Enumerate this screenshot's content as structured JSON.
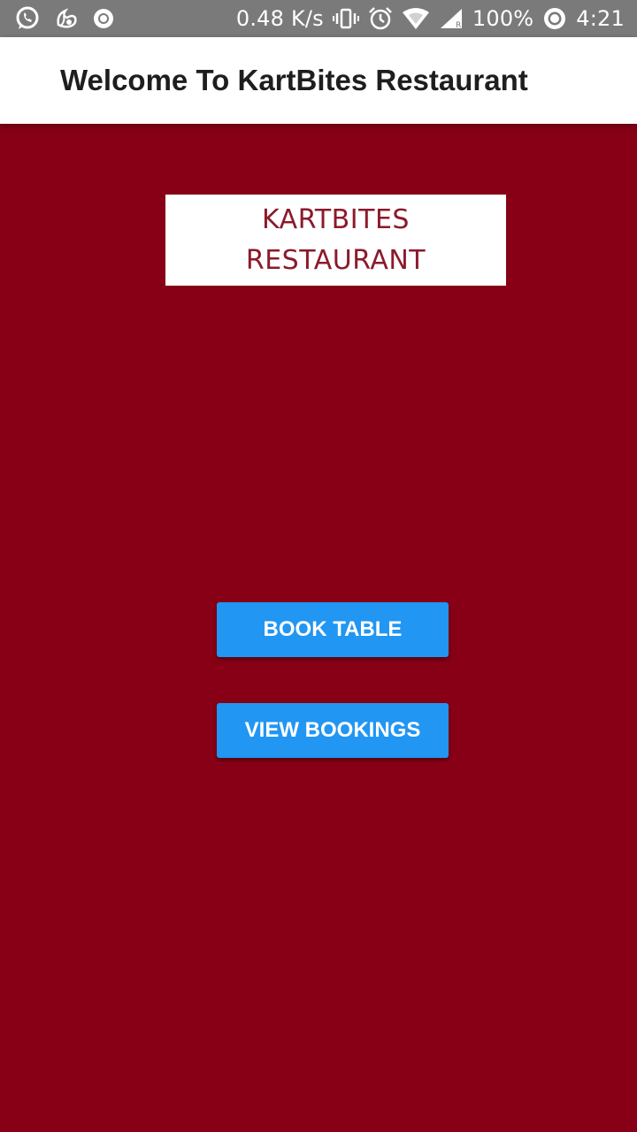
{
  "status_bar": {
    "network_speed": "0.48 K/s",
    "battery": "100%",
    "time": "4:21",
    "icons": [
      "whatsapp-icon",
      "uc-browser-icon",
      "record-icon",
      "vibrate-icon",
      "alarm-icon",
      "wifi-icon",
      "cell-signal-icon",
      "battery-saver-icon"
    ]
  },
  "app_bar": {
    "title": "Welcome To KartBites Restaurant"
  },
  "logo": {
    "line1": "KARTBITES",
    "line2": "RESTAURANT"
  },
  "actions": {
    "book_table": "BOOK TABLE",
    "view_bookings": "VIEW BOOKINGS"
  },
  "colors": {
    "background": "#870016",
    "button": "#2196f3",
    "app_bar": "#ffffff",
    "status_bar": "#7a7a7a",
    "logo_text": "#8b1a2a"
  }
}
